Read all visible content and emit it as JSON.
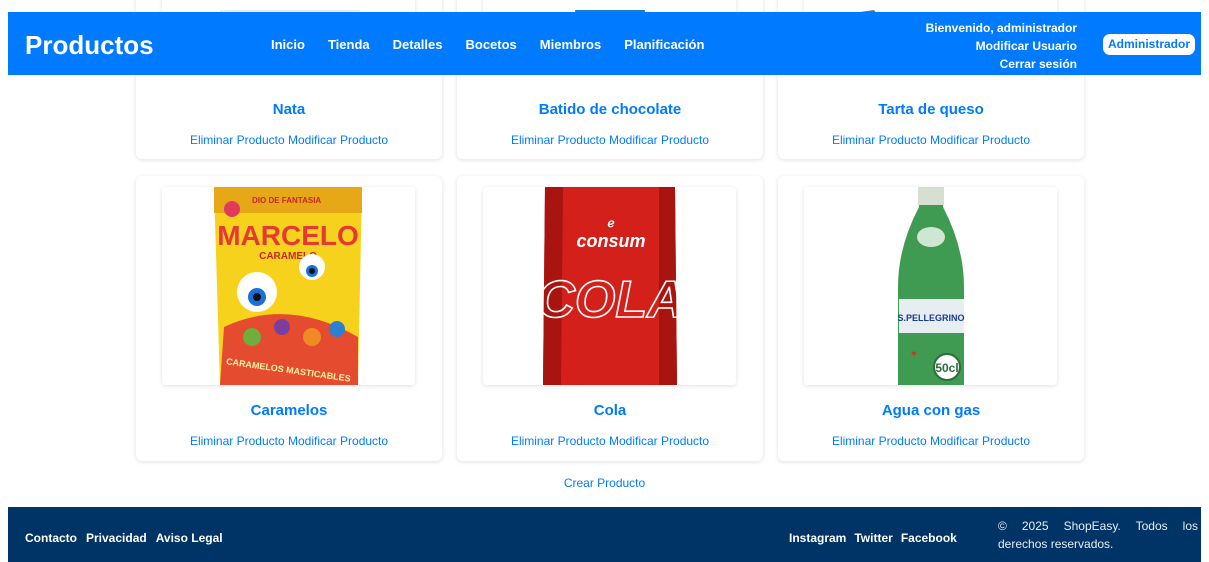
{
  "header": {
    "title": "Productos",
    "nav": [
      "Inicio",
      "Tienda",
      "Detalles",
      "Bocetos",
      "Miembros",
      "Planificación"
    ],
    "welcome": "Bienvenido, administrador",
    "modify_user": "Modificar Usuario",
    "logout": "Cerrar sesión",
    "role_button": "Administrador"
  },
  "products": [
    {
      "name": "Nata",
      "delete": "Eliminar Producto",
      "modify": "Modificar Producto"
    },
    {
      "name": "Batido de chocolate",
      "delete": "Eliminar Producto",
      "modify": "Modificar Producto"
    },
    {
      "name": "Tarta de queso",
      "delete": "Eliminar Producto",
      "modify": "Modificar Producto"
    },
    {
      "name": "Caramelos",
      "delete": "Eliminar Producto",
      "modify": "Modificar Producto",
      "image_text": {
        "brand": "DIO DE FANTASIA",
        "title": "MARCELO",
        "sub": "CARAMELO",
        "bottom": "CARAMELOS MASTICABLES"
      }
    },
    {
      "name": "Cola",
      "delete": "Eliminar Producto",
      "modify": "Modificar Producto",
      "image_text": {
        "brand": "consum",
        "title": "COLA"
      }
    },
    {
      "name": "Agua con gas",
      "delete": "Eliminar Producto",
      "modify": "Modificar Producto",
      "image_text": {
        "brand": "S.PELLEGRINO",
        "size": "50cl"
      }
    }
  ],
  "create_product": "Crear Producto",
  "footer": {
    "links": [
      "Contacto",
      "Privacidad",
      "Aviso Legal"
    ],
    "social": [
      "Instagram",
      "Twitter",
      "Facebook"
    ],
    "copyright": "© 2025 ShopEasy. Todos los derechos reservados."
  },
  "colors": {
    "primary": "#007bff",
    "footer": "#003366"
  }
}
